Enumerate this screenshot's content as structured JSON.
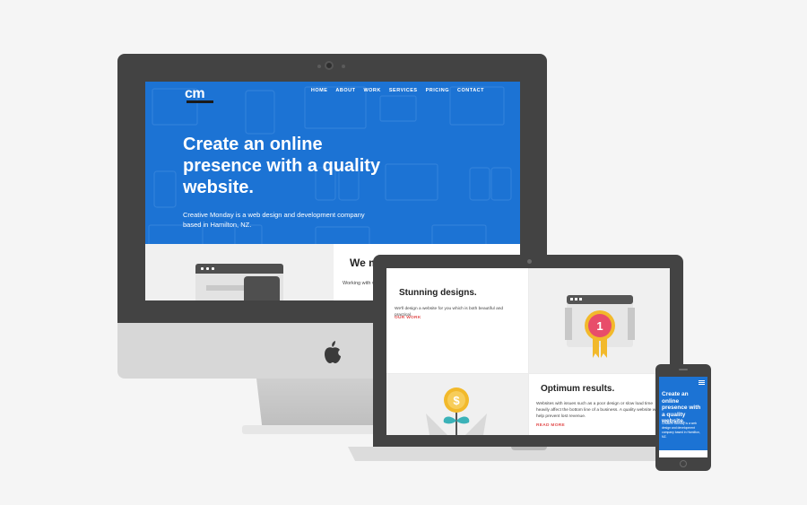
{
  "desktop": {
    "logo_text": "cm",
    "nav": [
      "HOME",
      "ABOUT",
      "WORK",
      "SERVICES",
      "PRICING",
      "CONTACT"
    ],
    "hero_title": "Create an online presence with a quality website.",
    "hero_subtitle": "Creative Monday is a web design and development company based in Hamilton, NZ.",
    "section_heading": "We m",
    "section_text": "Working with visitors - whe"
  },
  "laptop": {
    "card1_heading": "Stunning designs.",
    "card1_text": "We'll design a website for you which is both beautiful and practical.",
    "card1_link": "OUR WORK",
    "card2_heading": "Optimum results.",
    "card2_text": "Websites with issues such as a poor design or slow load time heavily affect the bottom line of a business. A quality website will help prevent lost revenue.",
    "card2_link": "READ MORE",
    "badge_number": "1",
    "coin_symbol": "$"
  },
  "phone": {
    "title": "Create an online presence with a quality website.",
    "subtitle": "Creative Monday is a web design and development company based in Hamilton, NZ."
  },
  "colors": {
    "brand_blue": "#1c73d4",
    "link_red": "#e24d4d",
    "device_dark": "#434343"
  }
}
